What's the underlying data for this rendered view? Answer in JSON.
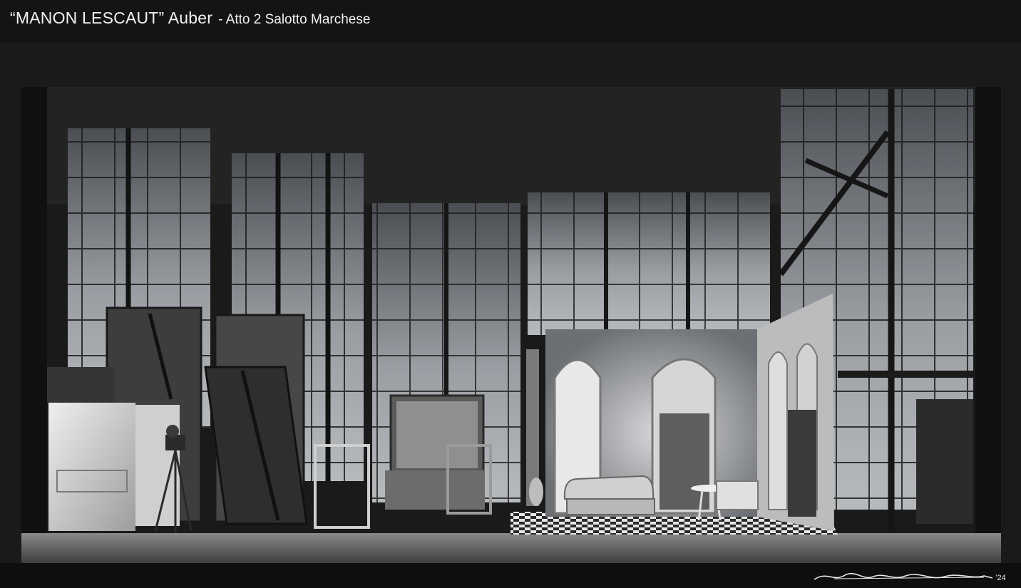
{
  "header": {
    "title": "“MANON LESCAUT” Auber",
    "subtitle": "- Atto 2 Salotto Marchese"
  },
  "signature": {
    "text": "Alessandro Ciammarughi '24",
    "year": "'24"
  },
  "colors": {
    "background": "#141414",
    "title": "#f2f2f2",
    "window_glass": "#8d9196",
    "panel_light": "#d4d4d4",
    "floor": "#6f6f6f"
  }
}
